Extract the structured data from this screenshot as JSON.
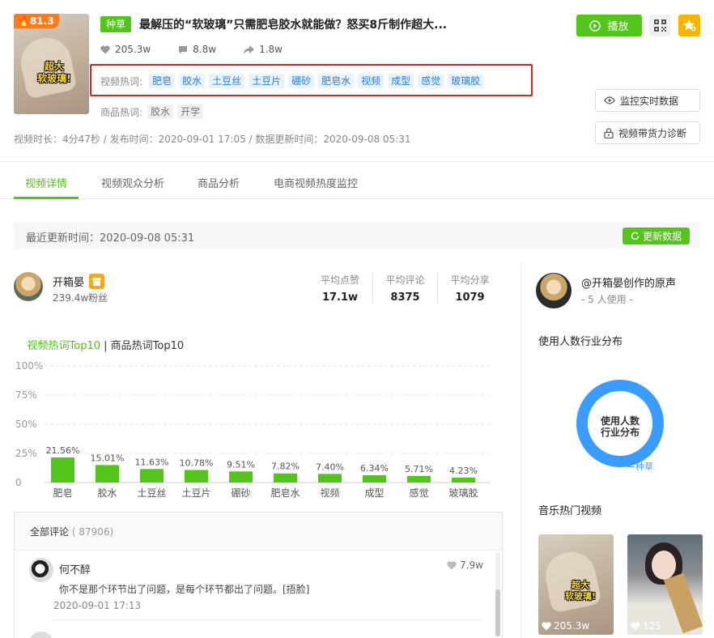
{
  "video": {
    "score": "81.3",
    "thumb_caption": "超大\n软玻璃!",
    "tag": "种草",
    "title": "最解压的“软玻璃”只需肥皂胶水就能做？怒买8斤制作超大...",
    "likes": "205.3w",
    "comments": "8.8w",
    "shares": "1.8w",
    "hotwords_label": "视频热词:",
    "hotwords": [
      "肥皂",
      "胶水",
      "土豆丝",
      "土豆片",
      "硼砂",
      "肥皂水",
      "视频",
      "成型",
      "感觉",
      "玻璃胶"
    ],
    "product_label": "商品热词:",
    "product_words": [
      "胶水",
      "开学"
    ],
    "meta_line": "视频时长：4分47秒 / 发布时间：2020-09-01 17:05 / 数据更新时间：2020-09-08 05:31"
  },
  "actions": {
    "play": "播放",
    "monitor": "监控实时数据",
    "diagnose": "视频带货力诊断"
  },
  "tabs": [
    "视频详情",
    "视频观众分析",
    "商品分析",
    "电商视频热度监控"
  ],
  "update_bar": {
    "text": "最近更新时间：2020-09-08 05:31",
    "button": "更新数据"
  },
  "author": {
    "name": "开箱晏",
    "fans": "239.4w粉丝",
    "stats": [
      {
        "label": "平均点赞",
        "value": "17.1w"
      },
      {
        "label": "平均评论",
        "value": "8375"
      },
      {
        "label": "平均分享",
        "value": "1079"
      }
    ]
  },
  "top10": {
    "active": "视频热词Top10",
    "sep": " | ",
    "other": "商品热词Top10"
  },
  "chart_data": {
    "type": "bar",
    "categories": [
      "肥皂",
      "胶水",
      "土豆丝",
      "土豆片",
      "硼砂",
      "肥皂水",
      "视频",
      "成型",
      "感觉",
      "玻璃胶"
    ],
    "values": [
      21.56,
      15.01,
      11.63,
      10.78,
      9.51,
      7.82,
      7.4,
      6.34,
      5.71,
      4.23
    ],
    "value_labels": [
      "21.56%",
      "15.01%",
      "11.63%",
      "10.78%",
      "9.51%",
      "7.82%",
      "7.40%",
      "6.34%",
      "5.71%",
      "4.23%"
    ],
    "y_ticks": [
      "100%",
      "75%",
      "50%",
      "25%",
      "0"
    ],
    "ylim": [
      0,
      100
    ],
    "color": "#52c41a",
    "grid": true
  },
  "comments": {
    "header": "全部评论",
    "count": "( 87906)",
    "items": [
      {
        "user": "何不醉",
        "likes": "7.9w",
        "text": "你不是那个环节出了问题，是每个环节都出了问题。[捂脸]",
        "time": "2020-09-01 17:13"
      }
    ]
  },
  "music": {
    "name": "@开箱晏创作的原声",
    "users": "- 5 人使用 -",
    "industry_title": "使用人数行业分布",
    "donut_label": "使用人数\n行业分布",
    "donut_legend": "种草",
    "hot_title": "音乐热门视频",
    "videos": [
      {
        "likes": "205.3w",
        "caption": "超大\n软玻璃!"
      },
      {
        "likes": "125"
      }
    ]
  },
  "colors": {
    "accent": "#52c41a",
    "highlight_box": "#e02020",
    "chip_bg": "#e9f3ff",
    "chip_text": "#2a7ae2",
    "star": "#f7b500",
    "donut": "#3b9cff"
  }
}
